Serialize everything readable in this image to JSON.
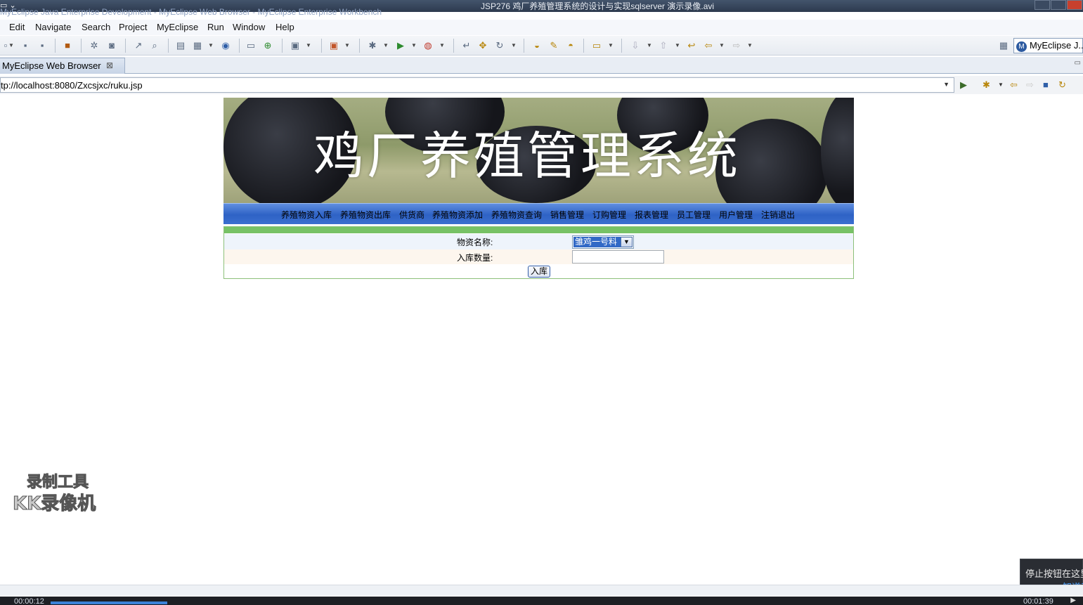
{
  "window": {
    "title": "JSP276 鸡厂养殖管理系统的设计与实现sqlserver 演示录像.avi",
    "ghost_title": "MyEclipse Java Enterprise Development - MyEclipse Web Browser - MyEclipse Enterprise Workbench"
  },
  "menubar": {
    "items": [
      "Edit",
      "Navigate",
      "Search",
      "Project",
      "MyEclipse",
      "Run",
      "Window",
      "Help"
    ]
  },
  "toolbar": {
    "perspective_label": "MyEclipse J..."
  },
  "editor": {
    "tab_label": "MyEclipse Web Browser",
    "url": "tp://localhost:8080/Zxcsjxc/ruku.jsp"
  },
  "site": {
    "banner_title": "鸡厂养殖管理系统",
    "nav": [
      "养殖物资入库",
      "养殖物资出库",
      "供货商",
      "养殖物资添加",
      "养殖物资查询",
      "销售管理",
      "订购管理",
      "报表管理",
      "员工管理",
      "用户管理",
      "注销退出"
    ],
    "form": {
      "material_label": "物资名称:",
      "material_value": "雏鸡一号料",
      "quantity_label": "入库数量:",
      "quantity_value": "",
      "submit_label": "入库"
    }
  },
  "watermark": {
    "line1": "录制工具",
    "line2": "KK录像机"
  },
  "player": {
    "elapsed": "00:00:12",
    "total": "00:01:39",
    "progress": 0.12
  },
  "tooltip": {
    "text": "停止按钮在这里",
    "link": "知道了"
  },
  "colors": {
    "navbar": "#2e62c5",
    "form_stripe": "#77c266",
    "selection": "#3169c6"
  }
}
